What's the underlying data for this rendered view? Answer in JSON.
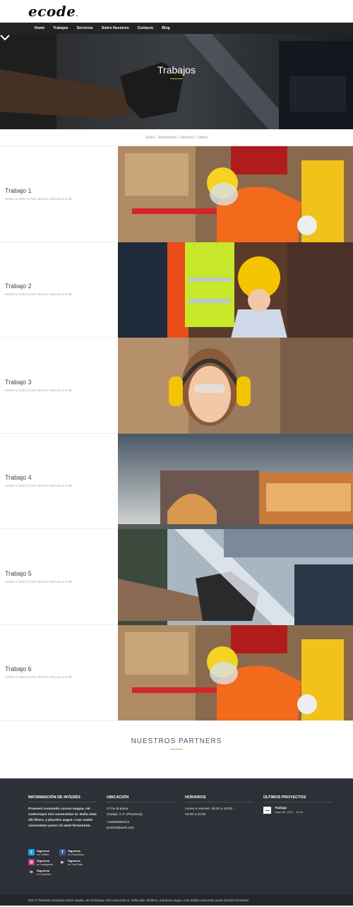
{
  "brand": {
    "logo": "ecode",
    "logo_dot": "."
  },
  "nav": {
    "items": [
      {
        "label": "Home"
      },
      {
        "label": "Trabajos"
      },
      {
        "label": "Servicios"
      },
      {
        "label": "Sobre Nosotros"
      },
      {
        "label": "Contacto"
      },
      {
        "label": "Blog"
      }
    ]
  },
  "hero": {
    "title": "Trabajos"
  },
  "filters": {
    "items": [
      "Todos",
      "Reparación",
      "Asesoría",
      "Obras"
    ],
    "separator": "/"
  },
  "works": [
    {
      "title": "Trabajo 1",
      "desc": "Nullam id dolor id nibh ultricies vehicula ut id elit.",
      "image": "worker-orange-helmet-forklift"
    },
    {
      "title": "Trabajo 2",
      "desc": "Nullam id dolor id nibh ultricies vehicula ut id elit.",
      "image": "woman-yellow-helmet-phone"
    },
    {
      "title": "Trabajo 3",
      "desc": "Nullam id dolor id nibh ultricies vehicula ut id elit.",
      "image": "woman-ear-protection"
    },
    {
      "title": "Trabajo 4",
      "desc": "Nullam id dolor id nibh ultricies vehicula ut id elit.",
      "image": "modern-building-dusk"
    },
    {
      "title": "Trabajo 5",
      "desc": "Nullam id dolor id nibh ultricies vehicula ut id elit.",
      "image": "gloved-hand-metal-press"
    },
    {
      "title": "Trabajo 6",
      "desc": "Nullam id dolor id nibh ultricies vehicula ut id elit.",
      "image": "worker-orange-helmet-forklift"
    }
  ],
  "partners": {
    "title": "NUESTROS PARTNERS"
  },
  "footer": {
    "info": {
      "title": "INFORMACIÓN DE INTERÉS",
      "text": "Praesent commodo cursus magna, vel scelerisque nisl consectetur et. Nulla vitae elit libero, a pharetra augue. Cras mattis consectetur purus sit amet fermentum."
    },
    "location": {
      "title": "UBICACIÓN",
      "line1": "C/ De la plaza",
      "line2": "Ciudad, C.P. (Provincia)",
      "phone": "+34666555444",
      "email": "prueba@web.com"
    },
    "hours": {
      "title": "HORARIOS",
      "line1": "Lunes a Viernes: 09:00 a 14:00 -",
      "line2": "16:00 a 19:00"
    },
    "projects": {
      "title": "ÚLTIMOS PROYECTOS",
      "items": [
        {
          "title": "Trabajo",
          "date": "mayo 05, 2021 · 10:44"
        }
      ]
    },
    "social": [
      {
        "line1": "Síguenos",
        "line2": "en Twitter",
        "color": "#1da1f2",
        "icon": "twitter-icon",
        "glyph": "t"
      },
      {
        "line1": "Síguenos",
        "line2": "en Facebook",
        "color": "#3b5998",
        "icon": "facebook-icon",
        "glyph": "f"
      },
      {
        "line1": "Síguenos",
        "line2": "en Instagram",
        "color": "#c13584",
        "icon": "instagram-icon",
        "glyph": "◎"
      },
      {
        "line1": "Síguenos",
        "line2": "en YouTube",
        "color": "#2d3137",
        "icon": "youtube-icon",
        "glyph": "▶"
      },
      {
        "line1": "Síguenos",
        "line2": "en LinkedIn",
        "color": "#2d3137",
        "icon": "linkedin-icon",
        "glyph": "in"
      }
    ],
    "copyright": "2021 © Praesent commodo cursus magna, vel scelerisque nisl consectetur et. Nulla vitae elit libero, a pharetra augue. Cras mattis consectetur purus sit amet fermentum."
  },
  "colors": {
    "accent": "#d9a640",
    "nav_bg": "#232323",
    "footer_bg": "#2d3137"
  }
}
